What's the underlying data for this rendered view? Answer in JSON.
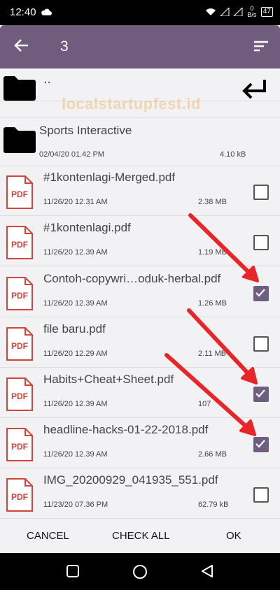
{
  "status": {
    "time": "12:40",
    "net_speed": "0 B/s",
    "battery": "47"
  },
  "toolbar": {
    "title": "3"
  },
  "parent_dir": {
    "label": ".."
  },
  "watermark": "localstartupfest.id",
  "folder": {
    "name": "Sports Interactive",
    "date": "02/04/20 01.42 PM",
    "size": "4.10 kB"
  },
  "files": [
    {
      "name": "#1kontenlagi-Merged.pdf",
      "date": "11/26/20 12.31 AM",
      "size": "2.38 MB",
      "checked": false
    },
    {
      "name": "#1kontenlagi.pdf",
      "date": "11/26/20 12.39 AM",
      "size": "1.19 MB",
      "checked": false
    },
    {
      "name": "Contoh-copywri…oduk-herbal.pdf",
      "date": "11/26/20 12.39 AM",
      "size": "1.26 MB",
      "checked": true
    },
    {
      "name": "file baru.pdf",
      "date": "11/26/20 12.29 AM",
      "size": "2.11 MB",
      "checked": false
    },
    {
      "name": "Habits+Cheat+Sheet.pdf",
      "date": "11/26/20 12.39 AM",
      "size": "107",
      "checked": true
    },
    {
      "name": "headline-hacks-01-22-2018.pdf",
      "date": "11/26/20 12.39 AM",
      "size": "2.66 MB",
      "checked": true
    },
    {
      "name": "IMG_20200929_041935_551.pdf",
      "date": "11/23/20 07.36 PM",
      "size": "62.79 kB",
      "checked": false
    }
  ],
  "pdf_badge": "PDF",
  "footer": {
    "cancel": "CANCEL",
    "check_all": "CHECK ALL",
    "ok": "OK"
  },
  "colors": {
    "toolbar": "#705c7c",
    "checkbox_checked": "#6e5f80",
    "arrow": "#e8262a",
    "pdf_red": "#d0443a"
  }
}
